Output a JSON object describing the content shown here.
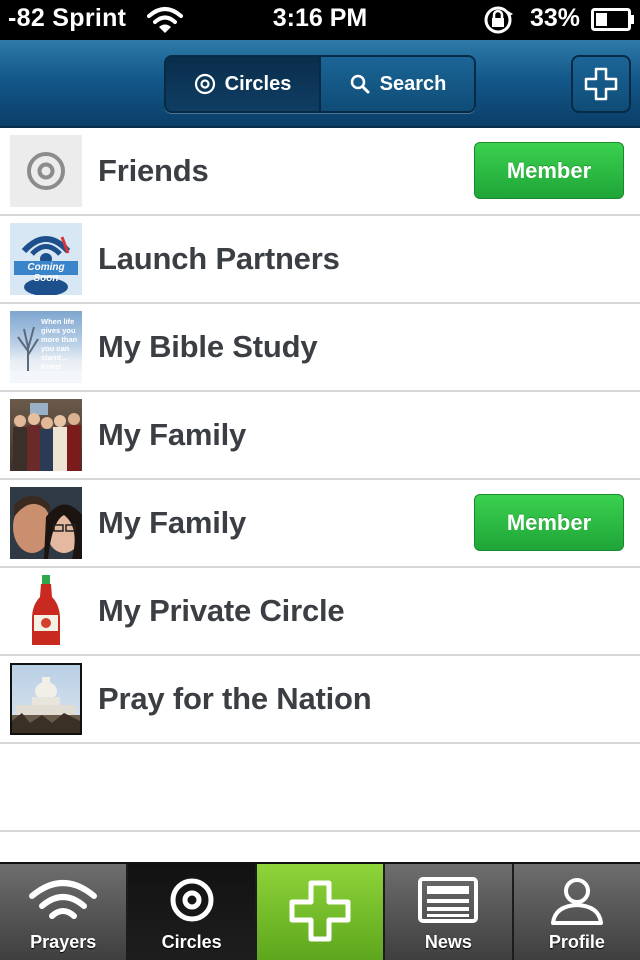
{
  "status_bar": {
    "carrier": "-82 Sprint",
    "time": "3:16 PM",
    "battery": "33%"
  },
  "nav": {
    "segments": [
      {
        "label": "Circles",
        "icon": "target-icon",
        "active": true
      },
      {
        "label": "Search",
        "icon": "search-icon",
        "active": false
      }
    ],
    "add_icon": "plus-icon"
  },
  "circles": [
    {
      "name": "Friends",
      "thumb": "target-icon",
      "member_label": "Member"
    },
    {
      "name": "Launch Partners",
      "thumb": "coming-soon-logo",
      "member_label": ""
    },
    {
      "name": "My Bible Study",
      "thumb": "winter-scene-photo",
      "member_label": ""
    },
    {
      "name": "My Family",
      "thumb": "family-group-photo",
      "member_label": ""
    },
    {
      "name": "My Family",
      "thumb": "couple-photo",
      "member_label": "Member"
    },
    {
      "name": "My Private Circle",
      "thumb": "hot-sauce-bottle-photo",
      "member_label": ""
    },
    {
      "name": "Pray for the Nation",
      "thumb": "capitol-building-photo",
      "member_label": ""
    }
  ],
  "thumb_texts": {
    "coming_soon": "Coming Soon",
    "bible_quote": "When life gives you more than you can stand... Kneel"
  },
  "tabs": [
    {
      "label": "Prayers",
      "icon": "wifi-signal-icon",
      "selected": false
    },
    {
      "label": "Circles",
      "icon": "target-icon",
      "selected": true
    },
    {
      "label": "",
      "icon": "plus-icon",
      "selected": false
    },
    {
      "label": "News",
      "icon": "newspaper-icon",
      "selected": false
    },
    {
      "label": "Profile",
      "icon": "person-icon",
      "selected": false
    }
  ],
  "colors": {
    "nav_blue": "#13588a",
    "member_green": "#2dbd44",
    "center_tab_green": "#7cc22e",
    "text_dark": "#3b3f44"
  }
}
